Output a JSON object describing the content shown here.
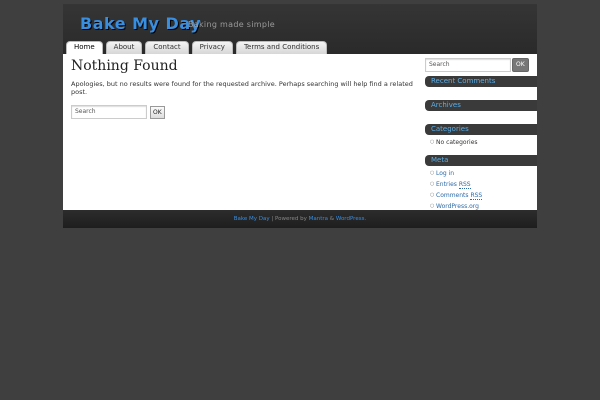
{
  "site": {
    "title": "Bake My Day",
    "description": "Baking made simple"
  },
  "menu": [
    {
      "label": "Home",
      "current": true
    },
    {
      "label": "About"
    },
    {
      "label": "Contact"
    },
    {
      "label": "Privacy"
    },
    {
      "label": "Terms and Conditions"
    }
  ],
  "content": {
    "heading": "Nothing Found",
    "message": "Apologies, but no results were found for the requested archive. Perhaps searching will help find a related post.",
    "search": {
      "placeholder": "Search",
      "button": "OK"
    }
  },
  "sidebar": {
    "search": {
      "placeholder": "Search",
      "button": "OK"
    },
    "recent_comments": {
      "title": "Recent Comments"
    },
    "archives": {
      "title": "Archives"
    },
    "categories": {
      "title": "Categories",
      "items": [
        "No categories"
      ]
    },
    "meta": {
      "title": "Meta",
      "items": [
        "Log in",
        "Entries RSS",
        "Comments RSS",
        "WordPress.org"
      ],
      "entries_prefix": "Entries ",
      "entries_abbr": "RSS",
      "comments_prefix": "Comments ",
      "comments_abbr": "RSS"
    }
  },
  "footer": {
    "site_link": "Bake My Day",
    "powered_by": " | Powered by ",
    "theme_link": "Mantra",
    "and": " & ",
    "wp_link": "WordPress."
  },
  "colors": {
    "background": "#3f3f3f",
    "accent": "#3a8ee0",
    "widget_title_bg": "#3a3a3a"
  },
  "icons": {
    "list_bullet": "bullet-icon"
  }
}
